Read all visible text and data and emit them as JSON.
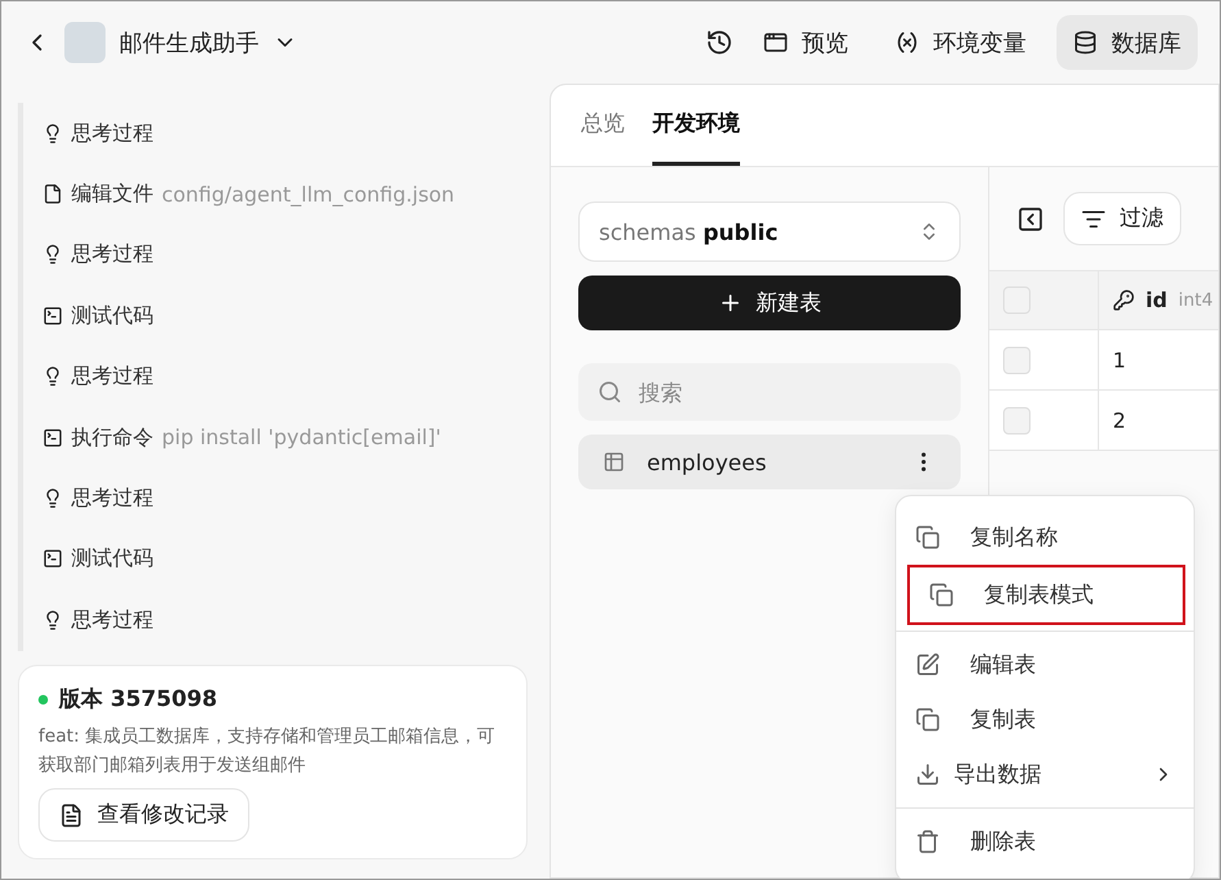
{
  "header": {
    "agent_name": "邮件生成助手",
    "tabs": [
      {
        "label": "预览",
        "kind": "preview",
        "selected": false
      },
      {
        "label": "环境变量",
        "kind": "variable",
        "selected": false
      },
      {
        "label": "数据库",
        "kind": "database",
        "selected": true
      }
    ]
  },
  "steps": [
    {
      "kind": "think",
      "label": "思考过程"
    },
    {
      "kind": "file",
      "label": "编辑文件",
      "detail": "config/agent_llm_config.json"
    },
    {
      "kind": "think",
      "label": "思考过程"
    },
    {
      "kind": "terminal",
      "label": "测试代码"
    },
    {
      "kind": "think",
      "label": "思考过程"
    },
    {
      "kind": "terminal",
      "label": "执行命令",
      "detail": "pip install 'pydantic[email]'"
    },
    {
      "kind": "think",
      "label": "思考过程"
    },
    {
      "kind": "terminal",
      "label": "测试代码"
    },
    {
      "kind": "think",
      "label": "思考过程"
    }
  ],
  "version": {
    "title": "版本 3575098",
    "color": "#22c55e",
    "message": "feat: 集成员工数据库，支持存储和管理员工邮箱信息，可获取部门邮箱列表用于发送组邮件",
    "button": "查看修改记录"
  },
  "db_tabs": [
    {
      "label": "总览",
      "selected": false
    },
    {
      "label": "开发环境",
      "selected": true
    }
  ],
  "schema": {
    "prefix": "schemas",
    "value": "public"
  },
  "new_table_button": "新建表",
  "search": {
    "placeholder": "搜索"
  },
  "tables": [
    {
      "name": "employees",
      "selected": true
    }
  ],
  "toolbar": {
    "filter": "过滤"
  },
  "grid": {
    "all_checked": false,
    "columns": [
      {
        "name": "id",
        "type": "int4",
        "primary_key": true
      }
    ],
    "rows": [
      {
        "checked": false,
        "cells": [
          "1"
        ]
      },
      {
        "checked": false,
        "cells": [
          "2"
        ]
      }
    ]
  },
  "context_menu": {
    "groups": [
      [
        {
          "kind": "copy",
          "label": "复制名称",
          "highlighted": false
        },
        {
          "kind": "copy",
          "label": "复制表模式",
          "highlighted": true
        }
      ],
      [
        {
          "kind": "edit",
          "label": "编辑表",
          "highlighted": false
        },
        {
          "kind": "copy",
          "label": "复制表",
          "highlighted": false
        },
        {
          "kind": "export",
          "label": "导出数据",
          "submenu": true,
          "highlighted": false
        }
      ],
      [
        {
          "kind": "delete",
          "label": "删除表",
          "highlighted": false
        }
      ]
    ]
  }
}
